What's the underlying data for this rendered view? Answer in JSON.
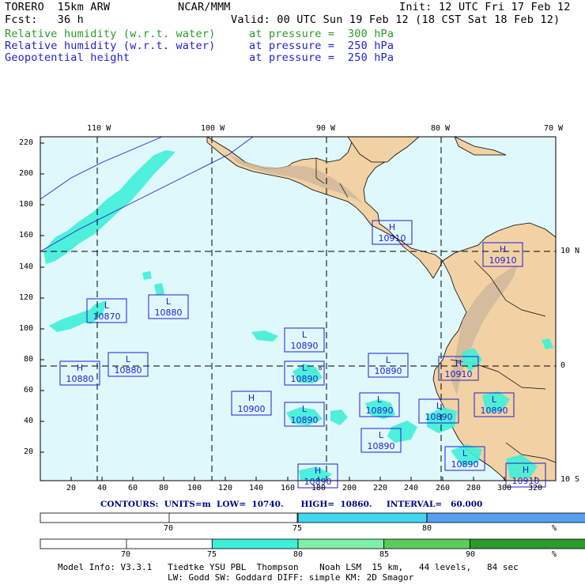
{
  "header": {
    "model": "TORERO  15km ARW",
    "org": "NCAR/MMM",
    "init": "Init: 12 UTC Fri 17 Feb 12",
    "fcst": "Fcst:   36 h",
    "valid": "Valid: 00 UTC Sun 19 Feb 12 (18 CST Sat 18 Feb 12)",
    "fields": [
      {
        "name": "Relative humidity (w.r.t. water)",
        "level": "at pressure =  300 hPa",
        "color": "#2a9a2a"
      },
      {
        "name": "Relative humidity (w.r.t. water)",
        "level": "at pressure =  250 hPa",
        "color": "#1f1fd0"
      },
      {
        "name": "Geopotential height",
        "level": "at pressure =  250 hPa",
        "color": "#1f1fd0"
      }
    ]
  },
  "map": {
    "top_lon_labels": [
      "110 W",
      "100 W",
      "90 W",
      "80 W",
      "70 W"
    ],
    "right_lat_labels": [
      "10 N",
      "0",
      "10 S"
    ],
    "left_ticks": [
      "220",
      "200",
      "180",
      "160",
      "140",
      "120",
      "100",
      "80",
      "60",
      "40",
      "20"
    ],
    "bottom_ticks": [
      "20",
      "40",
      "60",
      "80",
      "100",
      "120",
      "140",
      "160",
      "180",
      "200",
      "220",
      "240",
      "260",
      "280",
      "300",
      "320"
    ],
    "colors": {
      "ocean": "#dff8fb",
      "land": "#f2d2a4",
      "rh": "#3ff0d8"
    },
    "highs_lows": [
      {
        "type": "H",
        "value": "10910"
      },
      {
        "type": "H",
        "value": "10910"
      },
      {
        "type": "L",
        "value": "10870"
      },
      {
        "type": "L",
        "value": "10880"
      },
      {
        "type": "L",
        "value": "10890"
      },
      {
        "type": "H",
        "value": "10880"
      },
      {
        "type": "L",
        "value": "10880"
      },
      {
        "type": "L",
        "value": "10890"
      },
      {
        "type": "L",
        "value": "10890"
      },
      {
        "type": "H",
        "value": "10910"
      },
      {
        "type": "H",
        "value": "10900"
      },
      {
        "type": "L",
        "value": "10890"
      },
      {
        "type": "L",
        "value": "10890"
      },
      {
        "type": "L",
        "value": "10890"
      },
      {
        "type": "L",
        "value": "10890"
      },
      {
        "type": "L",
        "value": "10890"
      },
      {
        "type": "L",
        "value": "10890"
      },
      {
        "type": "H",
        "value": "10890"
      },
      {
        "type": "H",
        "value": "10910"
      }
    ]
  },
  "contours": {
    "text": "CONTOURS:  UNITS=m  LOW=  10740.      HIGH=  10860.     INTERVAL=   60.000"
  },
  "colorbar_250": {
    "segments": [
      {
        "from": 0,
        "to": 75,
        "color": "#ffffff"
      },
      {
        "from": 75,
        "to": 80,
        "color": "#3fd8f0"
      },
      {
        "from": 80,
        "to": 100,
        "color": "#5a9ef0"
      }
    ],
    "labels": [
      "70",
      "75",
      "80",
      "%"
    ]
  },
  "colorbar_300": {
    "segments": [
      {
        "from": 0,
        "to": 75,
        "color": "#ffffff"
      },
      {
        "from": 75,
        "to": 80,
        "color": "#3ff0d8"
      },
      {
        "from": 80,
        "to": 85,
        "color": "#7ff0a8"
      },
      {
        "from": 85,
        "to": 90,
        "color": "#5acc5a"
      },
      {
        "from": 90,
        "to": 100,
        "color": "#2a9a2a"
      }
    ],
    "labels": [
      "70",
      "75",
      "80",
      "85",
      "90",
      "%"
    ]
  },
  "footer": {
    "line1": "Model Info: V3.3.1   Tiedtke YSU PBL  Thompson    Noah LSM  15 km,   44 levels,   84 sec",
    "line2": "LW: Godd SW: Goddard DIFF: simple KM: 2D Smagor"
  }
}
